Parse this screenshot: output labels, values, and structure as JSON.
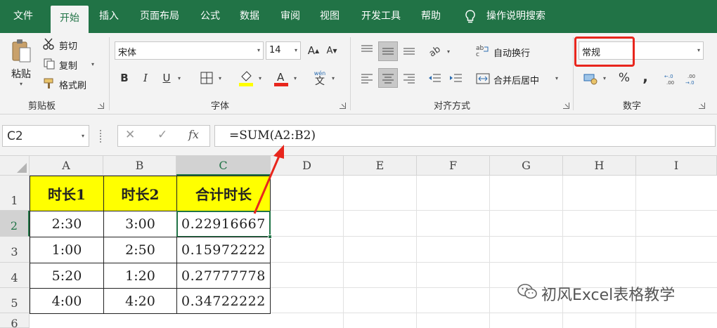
{
  "tabs": [
    "文件",
    "开始",
    "插入",
    "页面布局",
    "公式",
    "数据",
    "审阅",
    "视图",
    "开发工具",
    "帮助"
  ],
  "tell_me": "操作说明搜索",
  "clipboard": {
    "paste": "粘贴",
    "cut": "剪切",
    "copy": "复制",
    "format_painter": "格式刷",
    "label": "剪贴板"
  },
  "font": {
    "name": "宋体",
    "size": "14",
    "bold": "B",
    "italic": "I",
    "underline": "U",
    "label": "字体",
    "wen": "wén",
    "wen_char": "文"
  },
  "alignment": {
    "wrap_text": "自动换行",
    "merge_center": "合并后居中",
    "label": "对齐方式"
  },
  "number": {
    "format": "常规",
    "percent": "%",
    "comma": ",",
    "label": "数字"
  },
  "formula_bar": {
    "name_box": "C2",
    "fx": "fx",
    "formula": "=SUM(A2:B2)"
  },
  "columns": [
    "A",
    "B",
    "C",
    "D",
    "E",
    "F",
    "G",
    "H",
    "I"
  ],
  "rows": [
    "1",
    "2",
    "3",
    "4",
    "5",
    "6"
  ],
  "table": {
    "headers": [
      "时长1",
      "时长2",
      "合计时长"
    ],
    "rows": [
      [
        "2:30",
        "3:00",
        "0.22916667"
      ],
      [
        "1:00",
        "2:50",
        "0.15972222"
      ],
      [
        "5:20",
        "1:20",
        "0.27777778"
      ],
      [
        "4:00",
        "4:20",
        "0.34722222"
      ]
    ]
  },
  "watermark": "初风Excel表格教学",
  "colors": {
    "excel_green": "#217346",
    "header_fill": "#ffff00",
    "annotation_red": "#e8261d"
  }
}
